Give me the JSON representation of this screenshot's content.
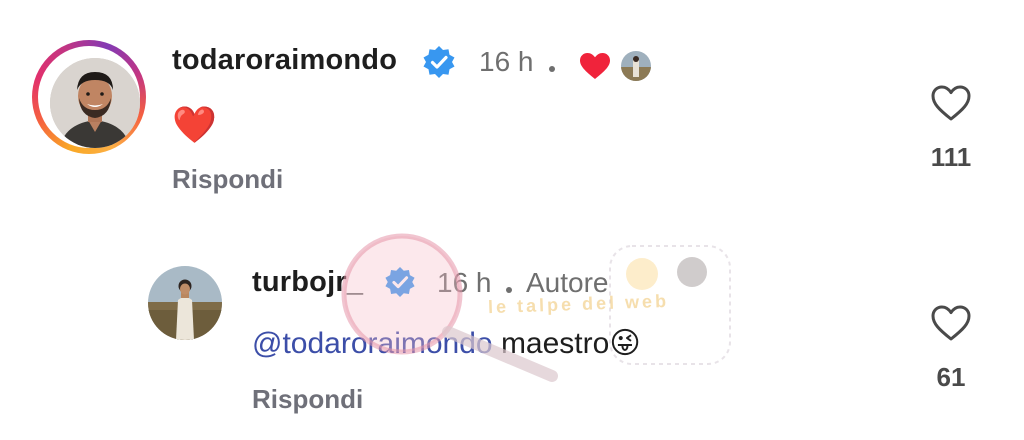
{
  "comments": [
    {
      "username": "todaroraimondo",
      "verified": true,
      "time": "16 h",
      "text": "❤️",
      "reply_label": "Rispondi",
      "like_count": "111",
      "liked_by_author": true
    },
    {
      "username": "turbojr_",
      "verified": true,
      "time": "16 h",
      "author_badge": "Autore",
      "mention": "@todaroraimondo",
      "text": "maestro",
      "emoji": "😜",
      "reply_label": "Rispondi",
      "like_count": "61"
    }
  ],
  "icons": {
    "verified": "verified-badge-icon",
    "like": "heart-outline-icon",
    "author_like": "heart-filled-icon"
  },
  "colors": {
    "verified_blue": "#3897f0",
    "heart_red": "#f0233b",
    "mention_blue": "#3c4ea8",
    "secondary_text": "#6f6f6f"
  },
  "watermark": {
    "text": "le talpe del web"
  }
}
